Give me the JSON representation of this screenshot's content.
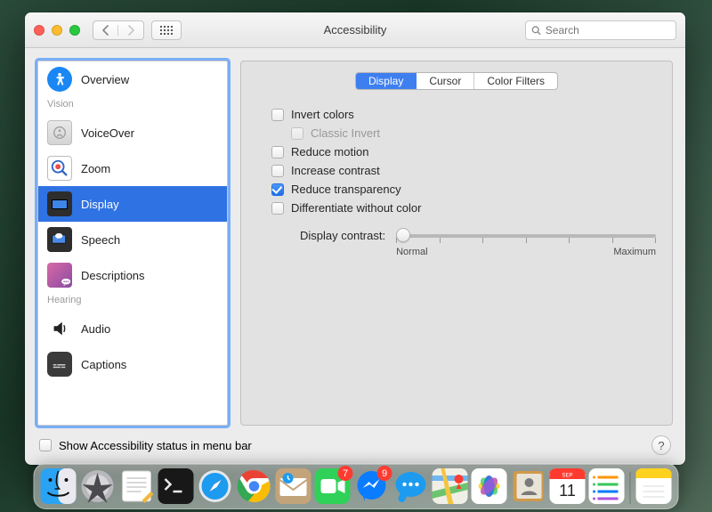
{
  "window": {
    "title": "Accessibility",
    "search_placeholder": "Search"
  },
  "sidebar": {
    "items": [
      {
        "label": "Overview"
      }
    ],
    "vision_header": "Vision",
    "vision": [
      {
        "label": "VoiceOver"
      },
      {
        "label": "Zoom"
      },
      {
        "label": "Display"
      },
      {
        "label": "Speech"
      },
      {
        "label": "Descriptions"
      }
    ],
    "hearing_header": "Hearing",
    "hearing": [
      {
        "label": "Audio"
      },
      {
        "label": "Captions"
      }
    ]
  },
  "tabs": {
    "display": "Display",
    "cursor": "Cursor",
    "color_filters": "Color Filters"
  },
  "options": {
    "invert_colors": "Invert colors",
    "classic_invert": "Classic Invert",
    "reduce_motion": "Reduce motion",
    "increase_contrast": "Increase contrast",
    "reduce_transparency": "Reduce transparency",
    "differentiate": "Differentiate without color"
  },
  "slider": {
    "label": "Display contrast:",
    "min_label": "Normal",
    "max_label": "Maximum"
  },
  "footer": {
    "menubar_checkbox": "Show Accessibility status in menu bar"
  },
  "dock": {
    "calendar_day": "11",
    "calendar_month": "SEP",
    "badge_facetime": "7",
    "badge_messenger": "9"
  }
}
